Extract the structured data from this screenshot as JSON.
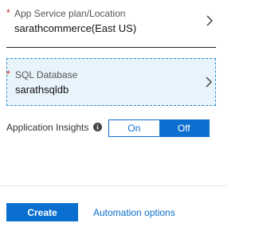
{
  "app_service_plan": {
    "required_marker": "*",
    "label": "App Service plan/Location",
    "value": "sarathcommerce(East US)",
    "icon": "chevron-right-icon"
  },
  "sql_database": {
    "required_marker": "*",
    "label": "SQL Database",
    "value": "sarathsqldb",
    "icon": "chevron-right-icon"
  },
  "application_insights": {
    "label": "Application Insights",
    "info_icon": "info-icon",
    "options": [
      "On",
      "Off"
    ],
    "selected": "Off"
  },
  "footer": {
    "create_label": "Create",
    "automation_label": "Automation options"
  },
  "colors": {
    "accent": "#0a6fcf",
    "required": "#d81b1b",
    "selected_field_bg": "#e8f4fb"
  }
}
